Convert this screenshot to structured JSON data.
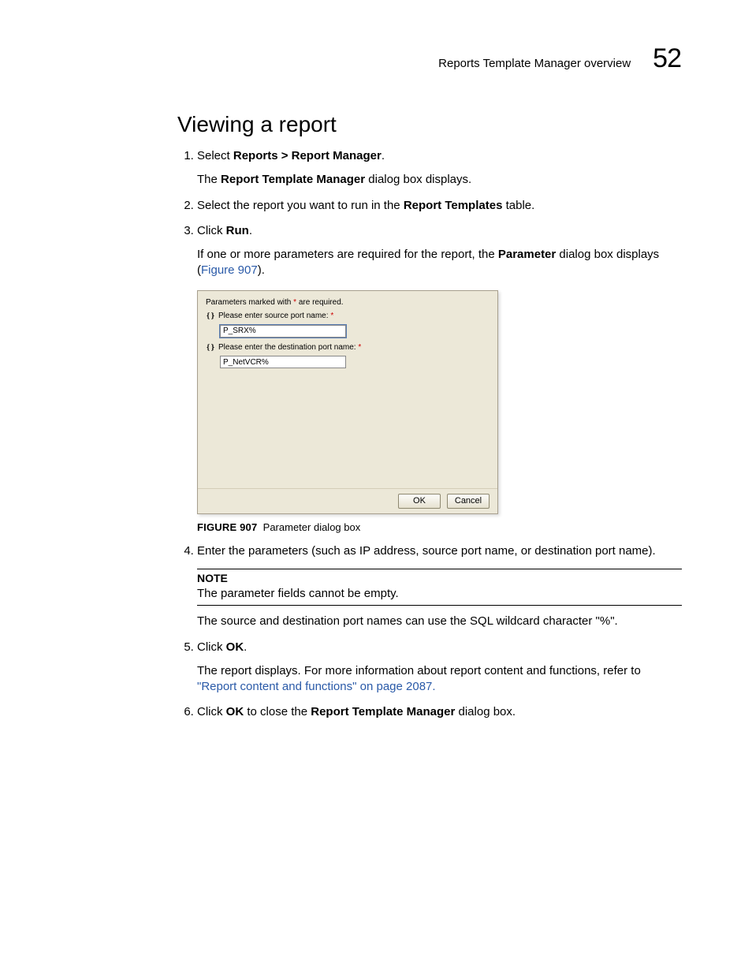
{
  "header": {
    "section": "Reports Template Manager overview",
    "page_number": "52"
  },
  "heading": "Viewing a report",
  "steps": {
    "s1": {
      "prefix": "Select ",
      "bold1": "Reports > Report Manager",
      "suffix1": ".",
      "body1_pre": "The ",
      "body1_bold": "Report Template Manager",
      "body1_post": " dialog box displays."
    },
    "s2": {
      "pre": "Select the report you want to run in the ",
      "bold": "Report Templates",
      "post": " table."
    },
    "s3": {
      "pre": "Click ",
      "bold": "Run",
      "post": ".",
      "body_pre": "If one or more parameters are required for the report, the ",
      "body_bold": "Parameter",
      "body_mid": " dialog box displays (",
      "body_link": "Figure 907",
      "body_post": ")."
    },
    "s4": {
      "text": "Enter the parameters (such as IP address, source port name, or destination port name).",
      "note_title": "NOTE",
      "note_text": "The parameter fields cannot be empty.",
      "after": "The source and destination port names can use the SQL wildcard character \"%\"."
    },
    "s5": {
      "pre": "Click ",
      "bold": "OK",
      "post": ".",
      "body_pre": "The report displays. For more information about report content and functions, refer to ",
      "body_link": "\"Report content and functions\"",
      "body_post": " on page 2087."
    },
    "s6": {
      "pre": "Click ",
      "bold1": "OK",
      "mid": " to close the ",
      "bold2": "Report Template Manager",
      "post": " dialog box."
    }
  },
  "dialog": {
    "required_pre": "Parameters marked with ",
    "required_star": "*",
    "required_post": " are required.",
    "param1_label": "Please enter source port name: ",
    "param1_star": "*",
    "param1_value": "P_SRX%",
    "param2_label": "Please enter the destination port name: ",
    "param2_star": "*",
    "param2_value": "P_NetVCR%",
    "ok": "OK",
    "cancel": "Cancel"
  },
  "figure": {
    "label": "FIGURE 907",
    "caption": "Parameter dialog box"
  }
}
